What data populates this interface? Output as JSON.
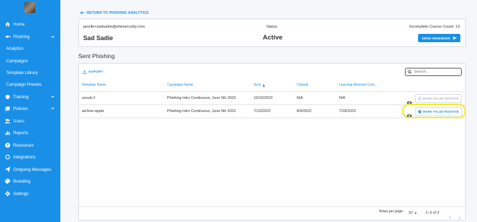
{
  "sidebar": {
    "items": [
      {
        "label": "Home",
        "icon": "home-icon"
      },
      {
        "label": "Phishing",
        "icon": "phishing-icon",
        "expanded": true
      },
      {
        "label": "Analytics"
      },
      {
        "label": "Campaigns"
      },
      {
        "label": "Template Library"
      },
      {
        "label": "Campaign Presets"
      },
      {
        "label": "Training",
        "icon": "training-icon"
      },
      {
        "label": "Policies",
        "icon": "policies-icon"
      },
      {
        "label": "Users",
        "icon": "users-icon"
      },
      {
        "label": "Reports",
        "icon": "reports-icon"
      },
      {
        "label": "Resources",
        "icon": "help-icon"
      },
      {
        "label": "Integrations",
        "icon": "integrations-icon"
      },
      {
        "label": "Outgoing Messages",
        "icon": "send-icon"
      },
      {
        "label": "Branding",
        "icon": "palette-icon"
      },
      {
        "label": "Settings",
        "icon": "gear-icon"
      }
    ]
  },
  "back_link": "RETURN TO PHISHING ANALYTICS",
  "user": {
    "email": "janelle+sadsadie@phinsecurity.com",
    "name": "Sad Sadie",
    "status_label": "Status",
    "status_value": "Active",
    "incomplete_label": "Incomplete Course Count: 13",
    "send_reminder": "SEND REMINDER"
  },
  "section_title": "Sent Phishing",
  "table": {
    "export_label": "EXPORT",
    "search_placeholder": "Search...",
    "columns": [
      "Template Name",
      "Campaign Name",
      "Sent",
      "Clicked",
      "Learning Moment Com..."
    ],
    "rows": [
      {
        "template": "unsub-2",
        "campaign": "Phishing Intro Continuous, June 5th 2023",
        "sent": "10/10/2023",
        "clicked": "N/A",
        "learning": "N/A",
        "action": "MARK FALSE POSITIVE",
        "enabled": false
      },
      {
        "template": "ad-free-apple",
        "campaign": "Phishing Intro Continuous, June 5th 2023",
        "sent": "7/13/2023",
        "clicked": "8/4/2023",
        "learning": "7/18/2023",
        "action": "MARK FALSE POSITIVE",
        "enabled": true
      }
    ],
    "rows_per_page_label": "Rows per page:",
    "rows_per_page": "10",
    "page_range": "1–2 of 2"
  },
  "colors": {
    "accent": "#1a8fe8",
    "highlight": "#f4ea2a"
  }
}
